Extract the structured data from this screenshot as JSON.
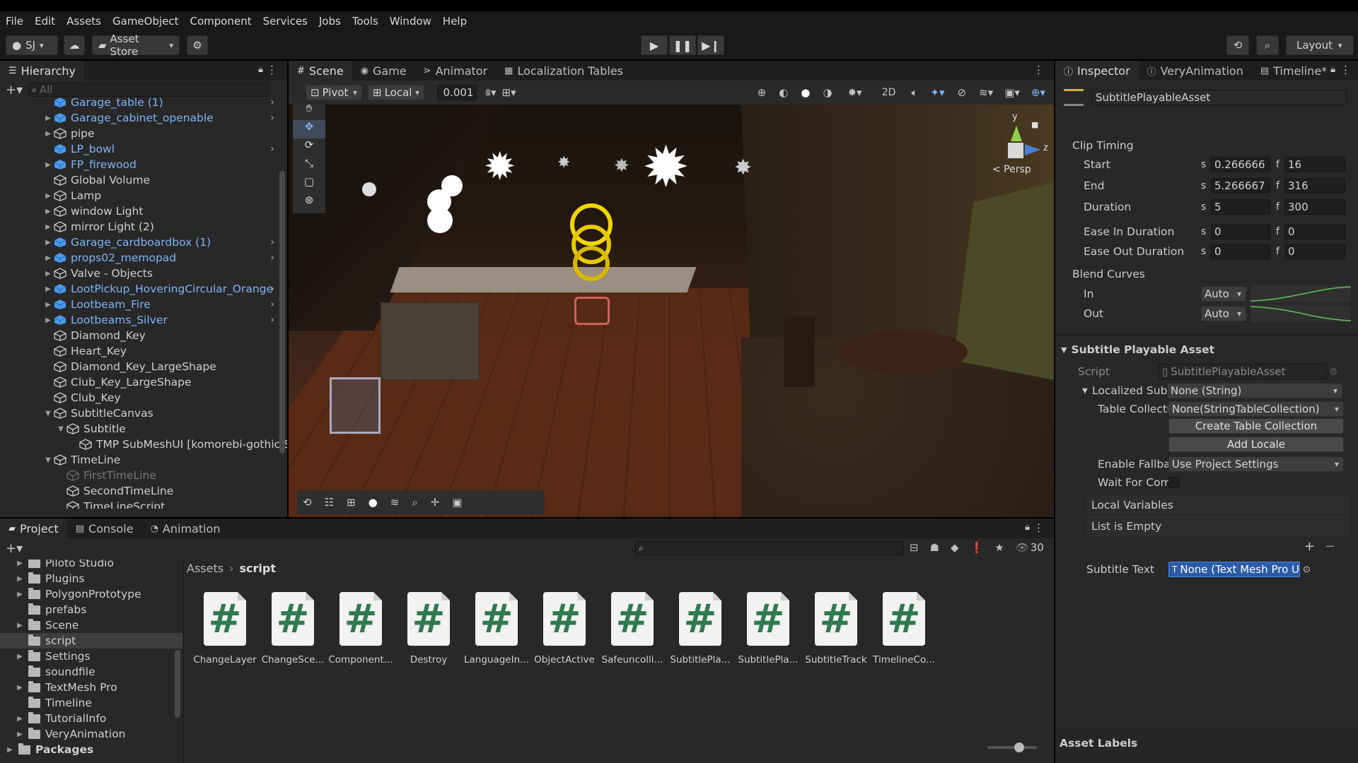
{
  "menu": [
    "File",
    "Edit",
    "Assets",
    "GameObject",
    "Component",
    "Services",
    "Jobs",
    "Tools",
    "Window",
    "Help"
  ],
  "toolbar": {
    "account": "SJ",
    "asset_store": "Asset Store",
    "layout": "Layout"
  },
  "hierarchy": {
    "title": "Hierarchy",
    "search_placeholder": "All",
    "items": [
      {
        "label": "Garage_table (1)",
        "indent": 0,
        "prefab": true,
        "expand": false,
        "arrow": true
      },
      {
        "label": "Garage_cabinet_openable",
        "indent": 0,
        "prefab": true,
        "expand": true,
        "arrow": true
      },
      {
        "label": "pipe",
        "indent": 0,
        "prefab": false,
        "expand": true,
        "arrow": false
      },
      {
        "label": "LP_bowl",
        "indent": 0,
        "prefab": true,
        "expand": false,
        "arrow": true
      },
      {
        "label": "FP_firewood",
        "indent": 0,
        "prefab": true,
        "expand": true,
        "arrow": false
      },
      {
        "label": "Global Volume",
        "indent": 0,
        "prefab": false,
        "expand": false,
        "arrow": false
      },
      {
        "label": "Lamp",
        "indent": 0,
        "prefab": false,
        "expand": true,
        "arrow": false
      },
      {
        "label": "window Light",
        "indent": 0,
        "prefab": false,
        "expand": true,
        "arrow": false
      },
      {
        "label": "mirror Light (2)",
        "indent": 0,
        "prefab": false,
        "expand": true,
        "arrow": false
      },
      {
        "label": "Garage_cardboardbox (1)",
        "indent": 0,
        "prefab": true,
        "expand": true,
        "arrow": true
      },
      {
        "label": "props02_memopad",
        "indent": 0,
        "prefab": true,
        "expand": true,
        "arrow": true
      },
      {
        "label": "Valve - Objects",
        "indent": 0,
        "prefab": false,
        "expand": true,
        "arrow": false
      },
      {
        "label": "LootPickup_HoveringCircular_Orange",
        "indent": 0,
        "prefab": true,
        "expand": true,
        "arrow": true
      },
      {
        "label": "Lootbeam_Fire",
        "indent": 0,
        "prefab": true,
        "expand": true,
        "arrow": true
      },
      {
        "label": "Lootbeams_Silver",
        "indent": 0,
        "prefab": true,
        "expand": true,
        "arrow": true
      },
      {
        "label": "Diamond_Key",
        "indent": 0,
        "prefab": false,
        "expand": false,
        "arrow": false
      },
      {
        "label": "Heart_Key",
        "indent": 0,
        "prefab": false,
        "expand": false,
        "arrow": false
      },
      {
        "label": "Diamond_Key_LargeShape",
        "indent": 0,
        "prefab": false,
        "expand": false,
        "arrow": false
      },
      {
        "label": "Club_Key_LargeShape",
        "indent": 0,
        "prefab": false,
        "expand": false,
        "arrow": false
      },
      {
        "label": "Club_Key",
        "indent": 0,
        "prefab": false,
        "expand": false,
        "arrow": false
      },
      {
        "label": "SubtitleCanvas",
        "indent": 0,
        "prefab": false,
        "expand": "open",
        "arrow": false
      },
      {
        "label": "Subtitle",
        "indent": 1,
        "prefab": false,
        "expand": "open",
        "arrow": false
      },
      {
        "label": "TMP SubMeshUI [komorebi-gothic S",
        "indent": 2,
        "prefab": false,
        "expand": false,
        "arrow": false
      },
      {
        "label": "TimeLine",
        "indent": 0,
        "prefab": false,
        "expand": "open",
        "arrow": false
      },
      {
        "label": "FirstTimeLine",
        "indent": 1,
        "prefab": false,
        "expand": false,
        "arrow": false,
        "disabled": true
      },
      {
        "label": "SecondTimeLine",
        "indent": 1,
        "prefab": false,
        "expand": false,
        "arrow": false
      },
      {
        "label": "TimeLineScript",
        "indent": 1,
        "prefab": false,
        "expand": false,
        "arrow": false
      }
    ]
  },
  "scene": {
    "tabs": [
      "Scene",
      "Game",
      "Animator",
      "Localization Tables"
    ],
    "pivot": "Pivot",
    "local": "Local",
    "snap": "0.001",
    "mode_2d": "2D",
    "persp": "< Persp",
    "axis_y": "y",
    "axis_z": "z"
  },
  "inspector": {
    "tabs": [
      "Inspector",
      "VeryAnimation",
      "Timeline*"
    ],
    "asset_name": "SubtitlePlayableAsset",
    "clip_timing": {
      "header": "Clip Timing",
      "unit_s": "s",
      "unit_f": "f",
      "rows": [
        {
          "label": "Start",
          "s": "0.266666",
          "f": "16"
        },
        {
          "label": "End",
          "s": "5.266667",
          "f": "316"
        },
        {
          "label": "Duration",
          "s": "5",
          "f": "300"
        },
        {
          "label": "Ease In Duration",
          "s": "0",
          "f": "0"
        },
        {
          "label": "Ease Out Duration",
          "s": "0",
          "f": "0"
        }
      ]
    },
    "blend_curves": {
      "header": "Blend Curves",
      "in_label": "In",
      "in_value": "Auto",
      "out_label": "Out",
      "out_value": "Auto"
    },
    "spa": {
      "header": "Subtitle Playable Asset",
      "script_label": "Script",
      "script_value": "SubtitlePlayableAsset",
      "localized_label": "Localized Subtitl",
      "localized_value": "None (String)",
      "table_label": "Table Collectior",
      "table_value": "None(StringTableCollection)",
      "create_button": "Create Table Collection",
      "add_locale_button": "Add Locale",
      "fallback_label": "Enable Fallback",
      "fallback_value": "Use Project Settings",
      "wait_label": "Wait For Compl",
      "local_vars": "Local Variables",
      "list_empty": "List is Empty",
      "plus": "+",
      "minus": "−",
      "subtitle_text_label": "Subtitle Text",
      "subtitle_text_value": "None (Text Mesh Pro U"
    },
    "asset_labels": "Asset Labels"
  },
  "project": {
    "tabs": [
      "Project",
      "Console",
      "Animation"
    ],
    "count": "30",
    "breadcrumb": [
      "Assets",
      "script"
    ],
    "tree": [
      {
        "label": "Piloto Studio",
        "expand": true
      },
      {
        "label": "Plugins",
        "expand": true
      },
      {
        "label": "PolygonPrototype",
        "expand": true
      },
      {
        "label": "prefabs",
        "expand": false
      },
      {
        "label": "Scene",
        "expand": true
      },
      {
        "label": "script",
        "expand": false,
        "selected": true
      },
      {
        "label": "Settings",
        "expand": true
      },
      {
        "label": "soundfile",
        "expand": false
      },
      {
        "label": "TextMesh Pro",
        "expand": true
      },
      {
        "label": "Timeline",
        "expand": false
      },
      {
        "label": "TutorialInfo",
        "expand": true
      },
      {
        "label": "VeryAnimation",
        "expand": true
      }
    ],
    "packages": "Packages",
    "assets": [
      "ChangeLayer",
      "ChangeSce...",
      "Component...",
      "Destroy",
      "LanguageIn...",
      "ObjectActive",
      "Safeuncolli...",
      "SubtitlePla...",
      "SubtitlePla...",
      "SubtitleTrack",
      "TimelineCo..."
    ],
    "asset_glyph": "#"
  }
}
